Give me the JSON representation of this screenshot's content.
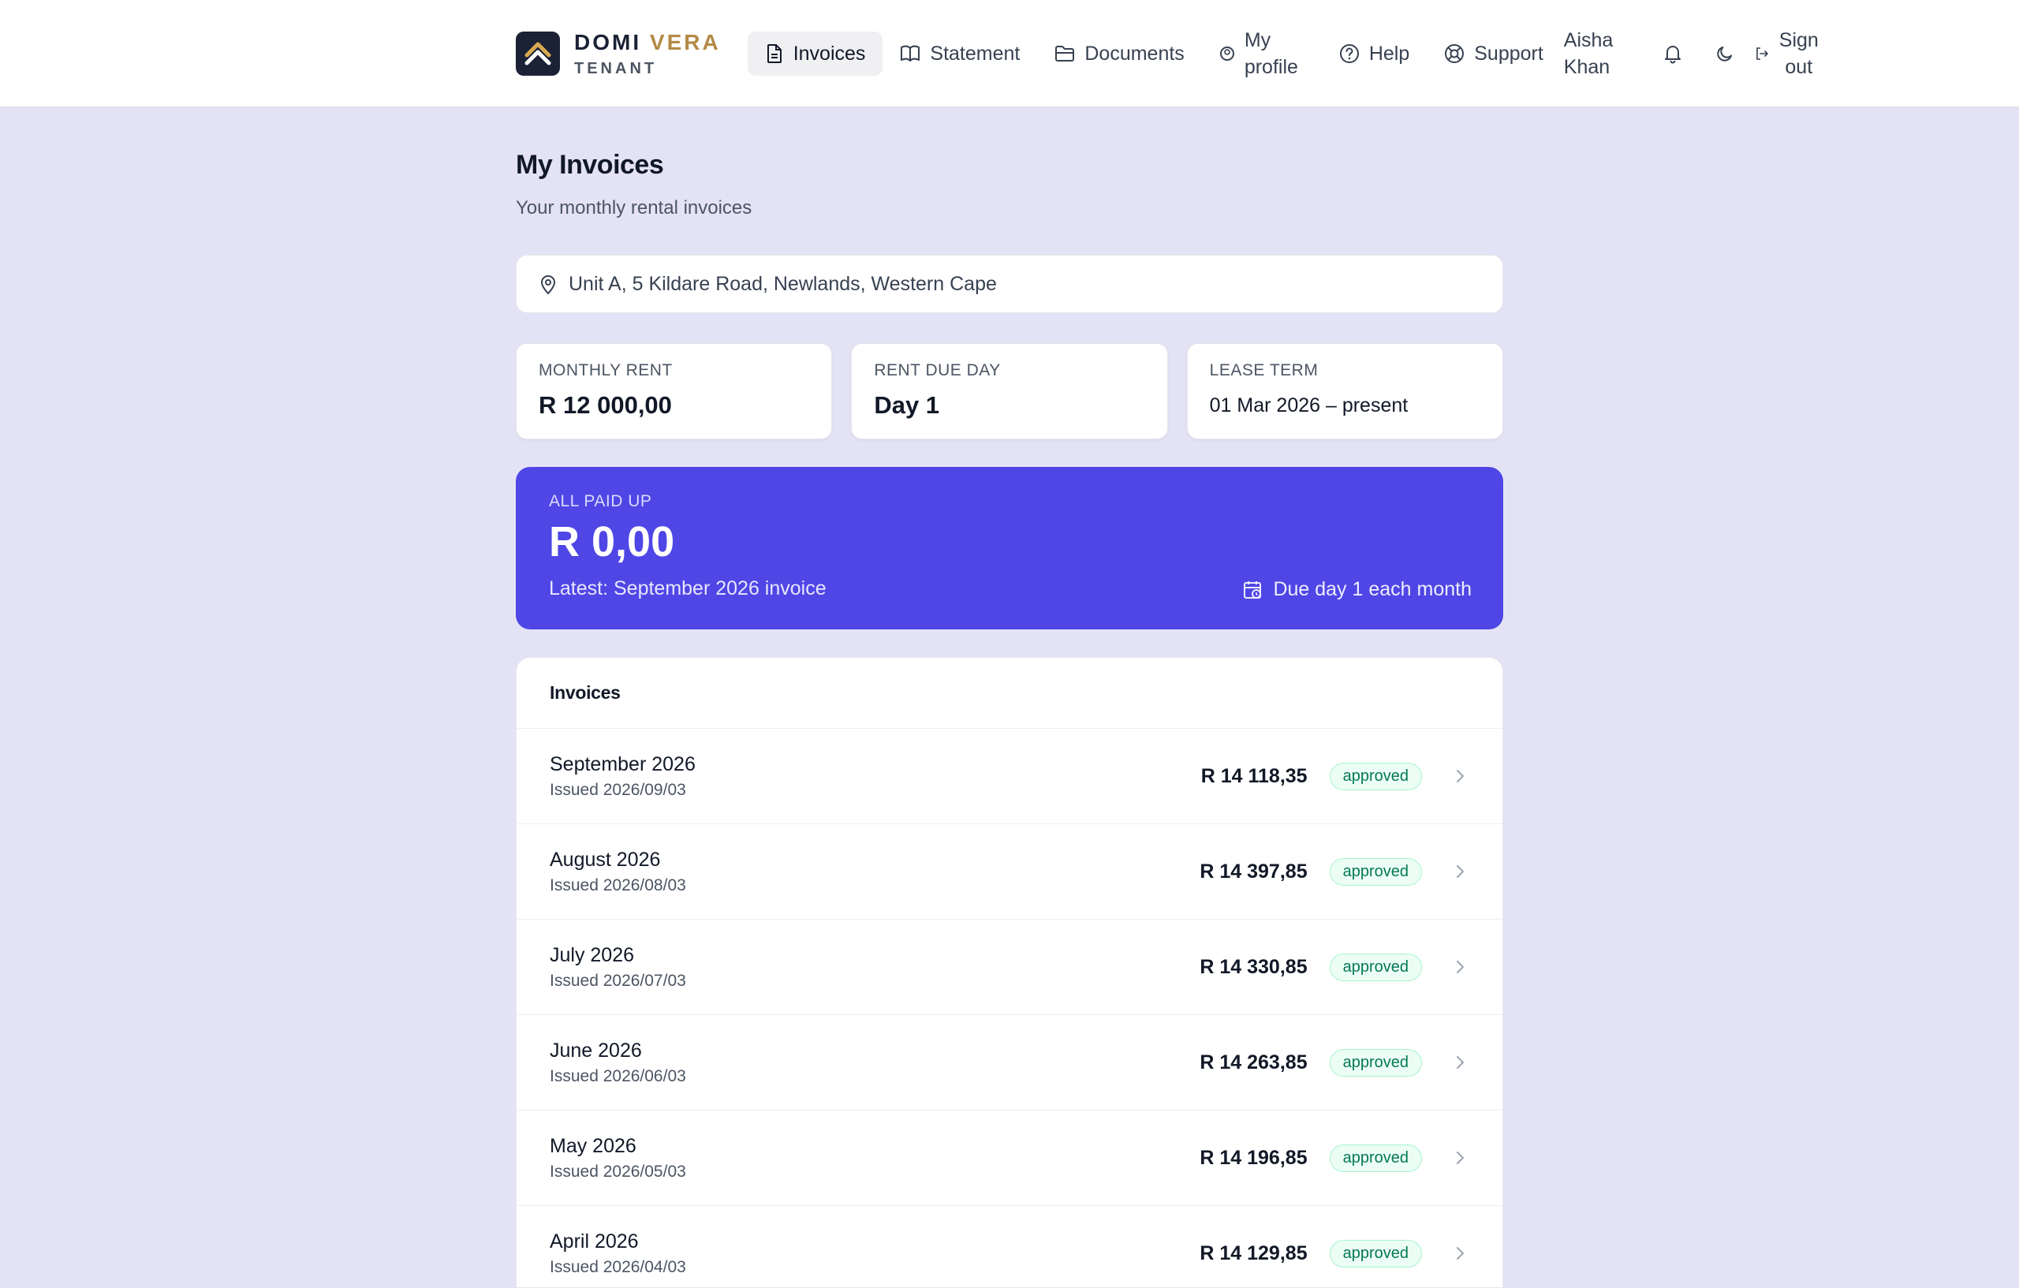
{
  "brand": {
    "name_part1": "DOMI",
    "name_part2": "VERA",
    "subtitle": "TENANT"
  },
  "nav": {
    "invoices": "Invoices",
    "statement": "Statement",
    "documents": "Documents",
    "profile_line1": "My",
    "profile_line2": "profile",
    "help": "Help",
    "support": "Support"
  },
  "user": {
    "first": "Aisha",
    "last": "Khan"
  },
  "signout": {
    "line1": "Sign",
    "line2": "out"
  },
  "page": {
    "title": "My Invoices",
    "subtitle": "Your monthly rental invoices"
  },
  "property": {
    "address": "Unit A, 5 Kildare Road, Newlands, Western Cape"
  },
  "stats": {
    "monthly_rent_label": "MONTHLY RENT",
    "monthly_rent_value": "R 12 000,00",
    "rent_due_label": "RENT DUE DAY",
    "rent_due_value": "Day 1",
    "lease_term_label": "LEASE TERM",
    "lease_term_value": "01 Mar 2026 – present"
  },
  "balance": {
    "label": "ALL PAID UP",
    "amount": "R 0,00",
    "latest": "Latest: September 2026 invoice",
    "due": "Due day 1 each month"
  },
  "invoices": {
    "header": "Invoices",
    "rows": [
      {
        "month": "September 2026",
        "issued": "Issued 2026/09/03",
        "amount": "R 14 118,35",
        "status": "approved"
      },
      {
        "month": "August 2026",
        "issued": "Issued 2026/08/03",
        "amount": "R 14 397,85",
        "status": "approved"
      },
      {
        "month": "July 2026",
        "issued": "Issued 2026/07/03",
        "amount": "R 14 330,85",
        "status": "approved"
      },
      {
        "month": "June 2026",
        "issued": "Issued 2026/06/03",
        "amount": "R 14 263,85",
        "status": "approved"
      },
      {
        "month": "May 2026",
        "issued": "Issued 2026/05/03",
        "amount": "R 14 196,85",
        "status": "approved"
      },
      {
        "month": "April 2026",
        "issued": "Issued 2026/04/03",
        "amount": "R 14 129,85",
        "status": "approved"
      }
    ]
  },
  "colors": {
    "accent": "#4f46e5",
    "brand_gold": "#b38a45",
    "background": "#e4e3f5",
    "approved": "#047857"
  }
}
